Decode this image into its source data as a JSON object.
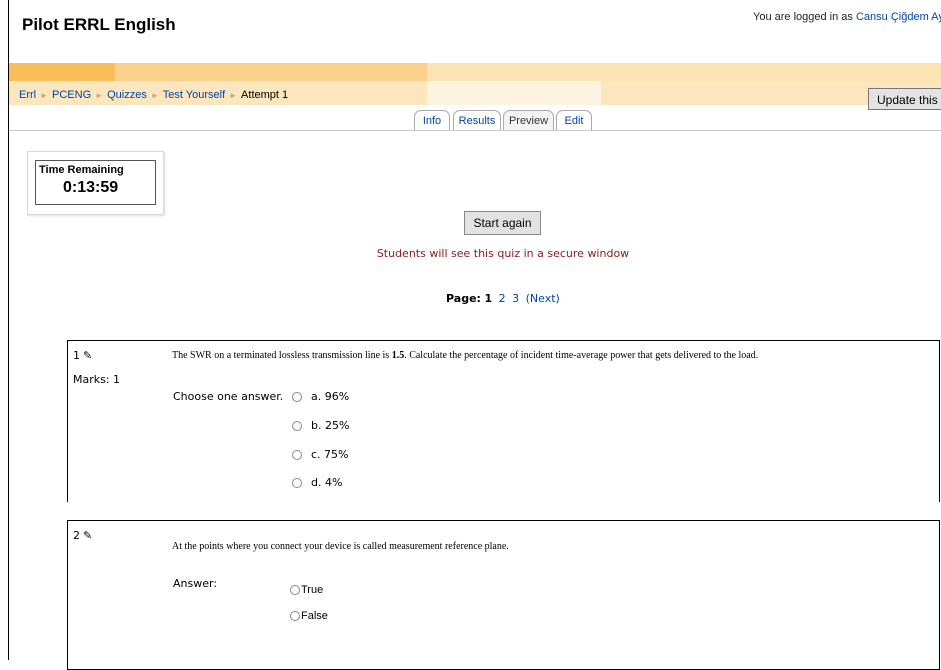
{
  "header": {
    "site_title": "Pilot ERRL English",
    "login_prefix": "You are logged in as",
    "user_name": "Cansu Çiğdem Aydı"
  },
  "breadcrumb": {
    "items": [
      "Errl",
      "PCENG",
      "Quizzes",
      "Test Yourself"
    ],
    "current": "Attempt 1"
  },
  "update_button": "Update this",
  "tabs": [
    {
      "label": "Info",
      "active": false
    },
    {
      "label": "Results",
      "active": false
    },
    {
      "label": "Preview",
      "active": true
    },
    {
      "label": "Edit",
      "active": false
    }
  ],
  "timer": {
    "label": "Time Remaining",
    "value": "0:13:59"
  },
  "start_again": "Start again",
  "secure_notice": "Students will see this quiz in a secure window",
  "paging": {
    "label": "Page:",
    "current": "1",
    "pages": [
      "2",
      "3"
    ],
    "next": "(Next)"
  },
  "questions": [
    {
      "number": "1",
      "marks_label": "Marks: 1",
      "text_before": "The SWR on a terminated lossless transmission line is",
      "text_bold": "1.5",
      "text_after": ". Calculate the percentage of incident time-average power that gets delivered to the load.",
      "prompt": "Choose one answer.",
      "options": [
        "a. 96%",
        "b. 25%",
        "c. 75%",
        "d. 4%"
      ]
    },
    {
      "number": "2",
      "text": "At the points where you connect your device is called measurement reference plane.",
      "prompt": "Answer:",
      "options": [
        "True",
        "False"
      ]
    }
  ],
  "colors": {
    "stripe_dark": "#f9bd5a",
    "stripe_mid": "#fbd08a",
    "stripe_light": "#fde2b2",
    "link": "#0044aa",
    "notice": "#8b1a1a"
  },
  "icons": {
    "edit": "pencil-icon"
  }
}
